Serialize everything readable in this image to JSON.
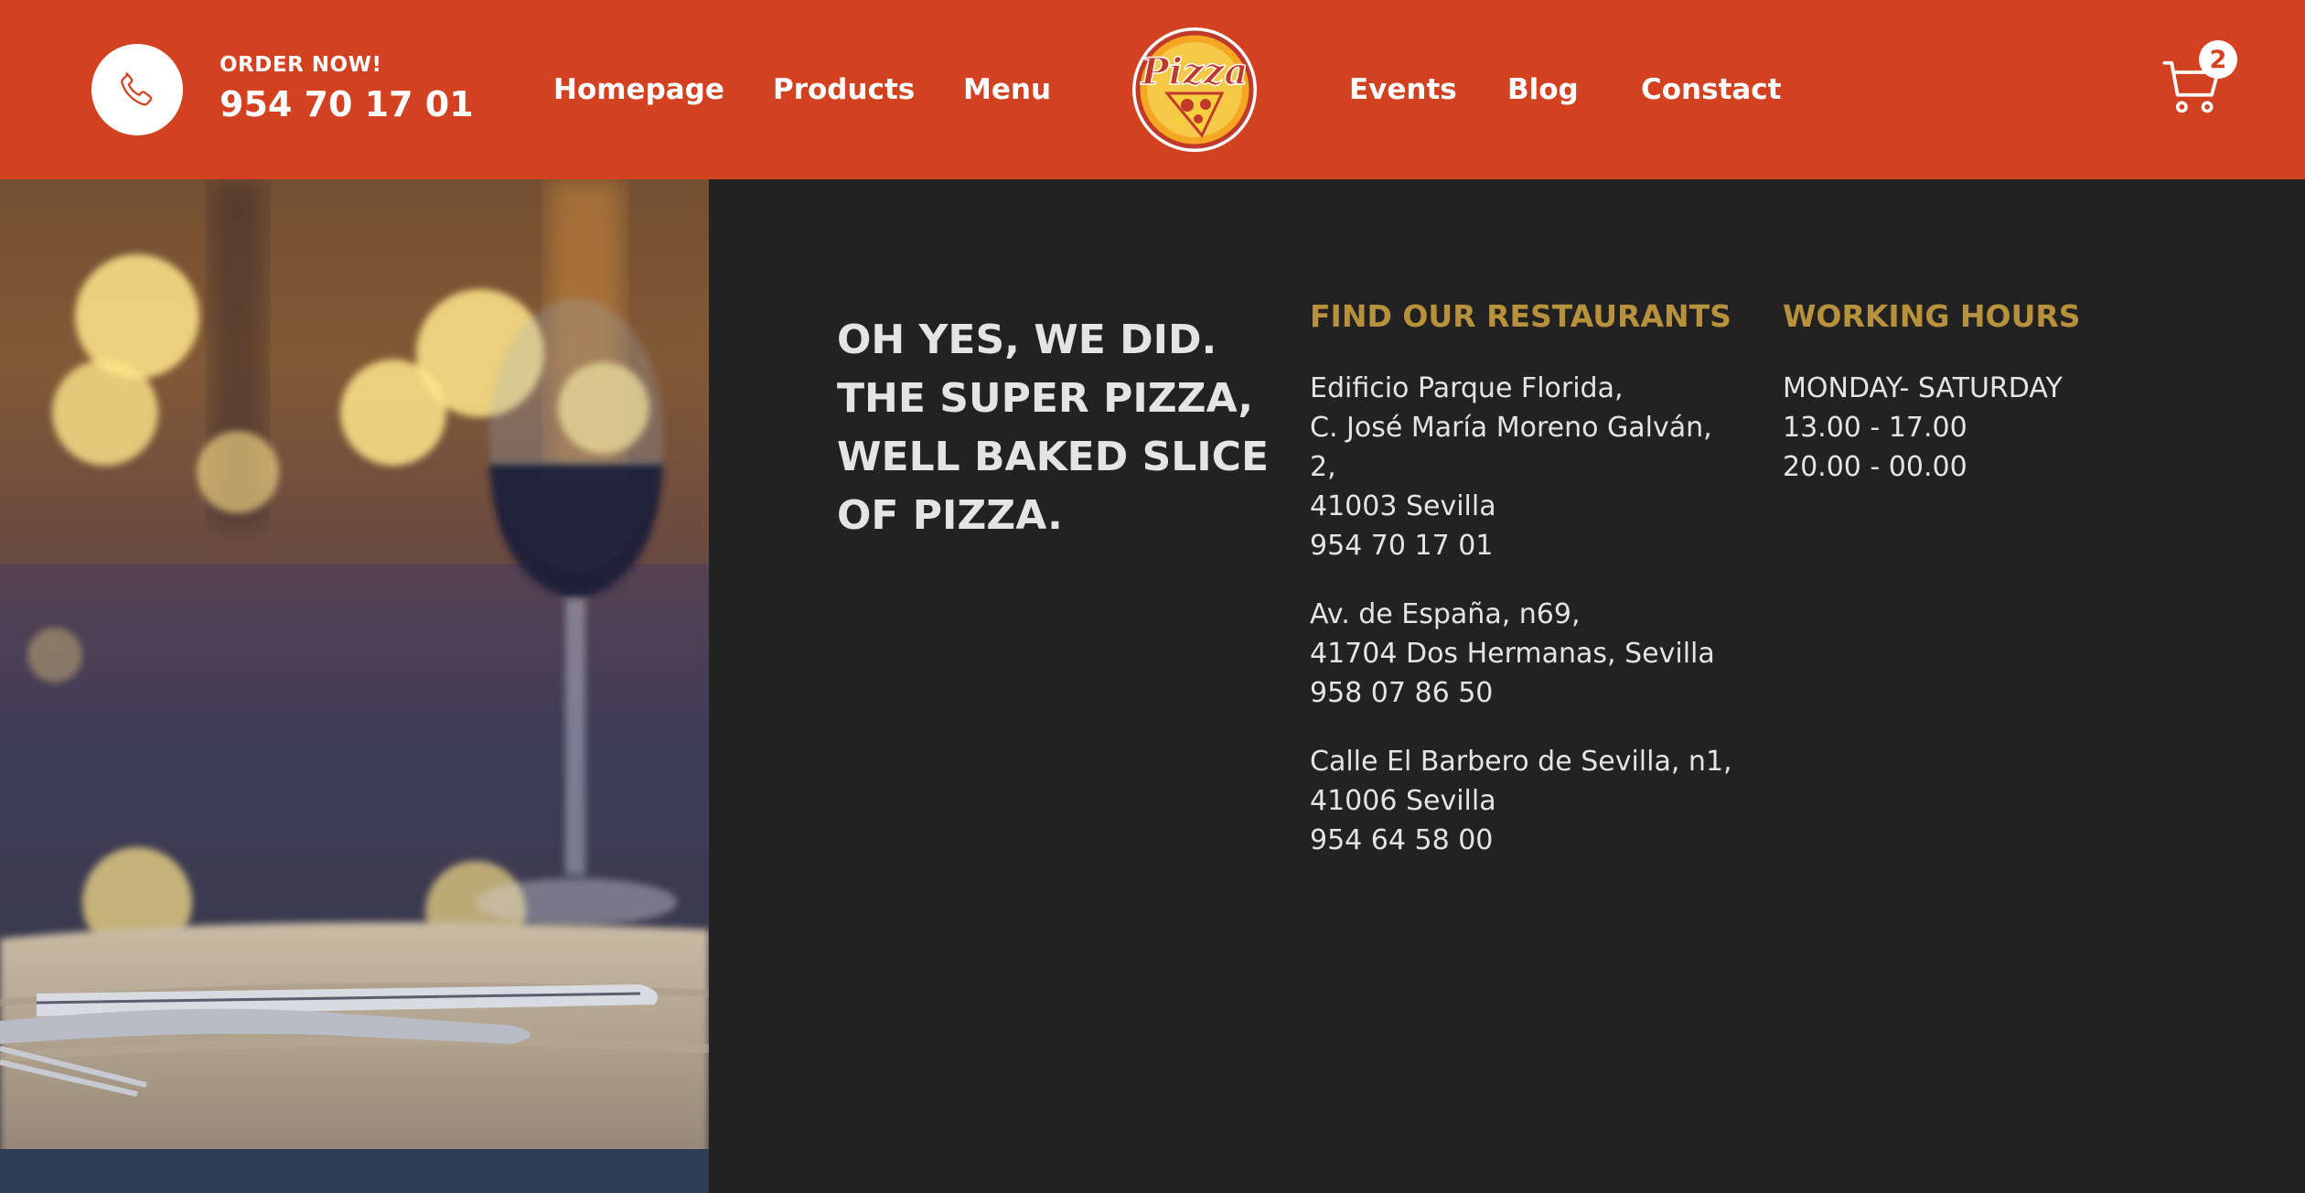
{
  "header": {
    "order_label": "ORDER NOW!",
    "order_phone": "954 70 17 01",
    "nav_left": [
      "Homepage",
      "Products",
      "Menu"
    ],
    "nav_right": [
      "Events",
      "Blog",
      "Constact"
    ],
    "logo_text": "Pizza",
    "cart_count": "2",
    "colors": {
      "background": "#d24120",
      "text": "#ffffff"
    }
  },
  "main": {
    "headline": [
      "OH YES, WE DID.",
      "THE SUPER PIZZA,",
      "WELL BAKED SLICE",
      "OF PIZZA."
    ],
    "restaurants": {
      "title": "FIND OUR RESTAURANTS",
      "locations": [
        [
          "Edificio Parque Florida,",
          "C. José María Moreno Galván,",
          "2,",
          "41003 Sevilla",
          "954 70 17 01"
        ],
        [
          "Av. de España, n69,",
          "41704 Dos Hermanas, Sevilla",
          "958 07 86 50"
        ],
        [
          "Calle El Barbero de Sevilla, n1,",
          "41006 Sevilla",
          "954 64 58 00"
        ]
      ]
    },
    "hours": {
      "title": "WORKING HOURS",
      "lines": [
        "MONDAY- SATURDAY",
        "13.00 - 17.00",
        "20.00 - 00.00"
      ]
    },
    "colors": {
      "background": "#222222",
      "accent": "#b8913d",
      "text": "#e4e4e4"
    }
  },
  "icons": [
    "phone-icon",
    "pizza-logo",
    "cart-icon"
  ]
}
